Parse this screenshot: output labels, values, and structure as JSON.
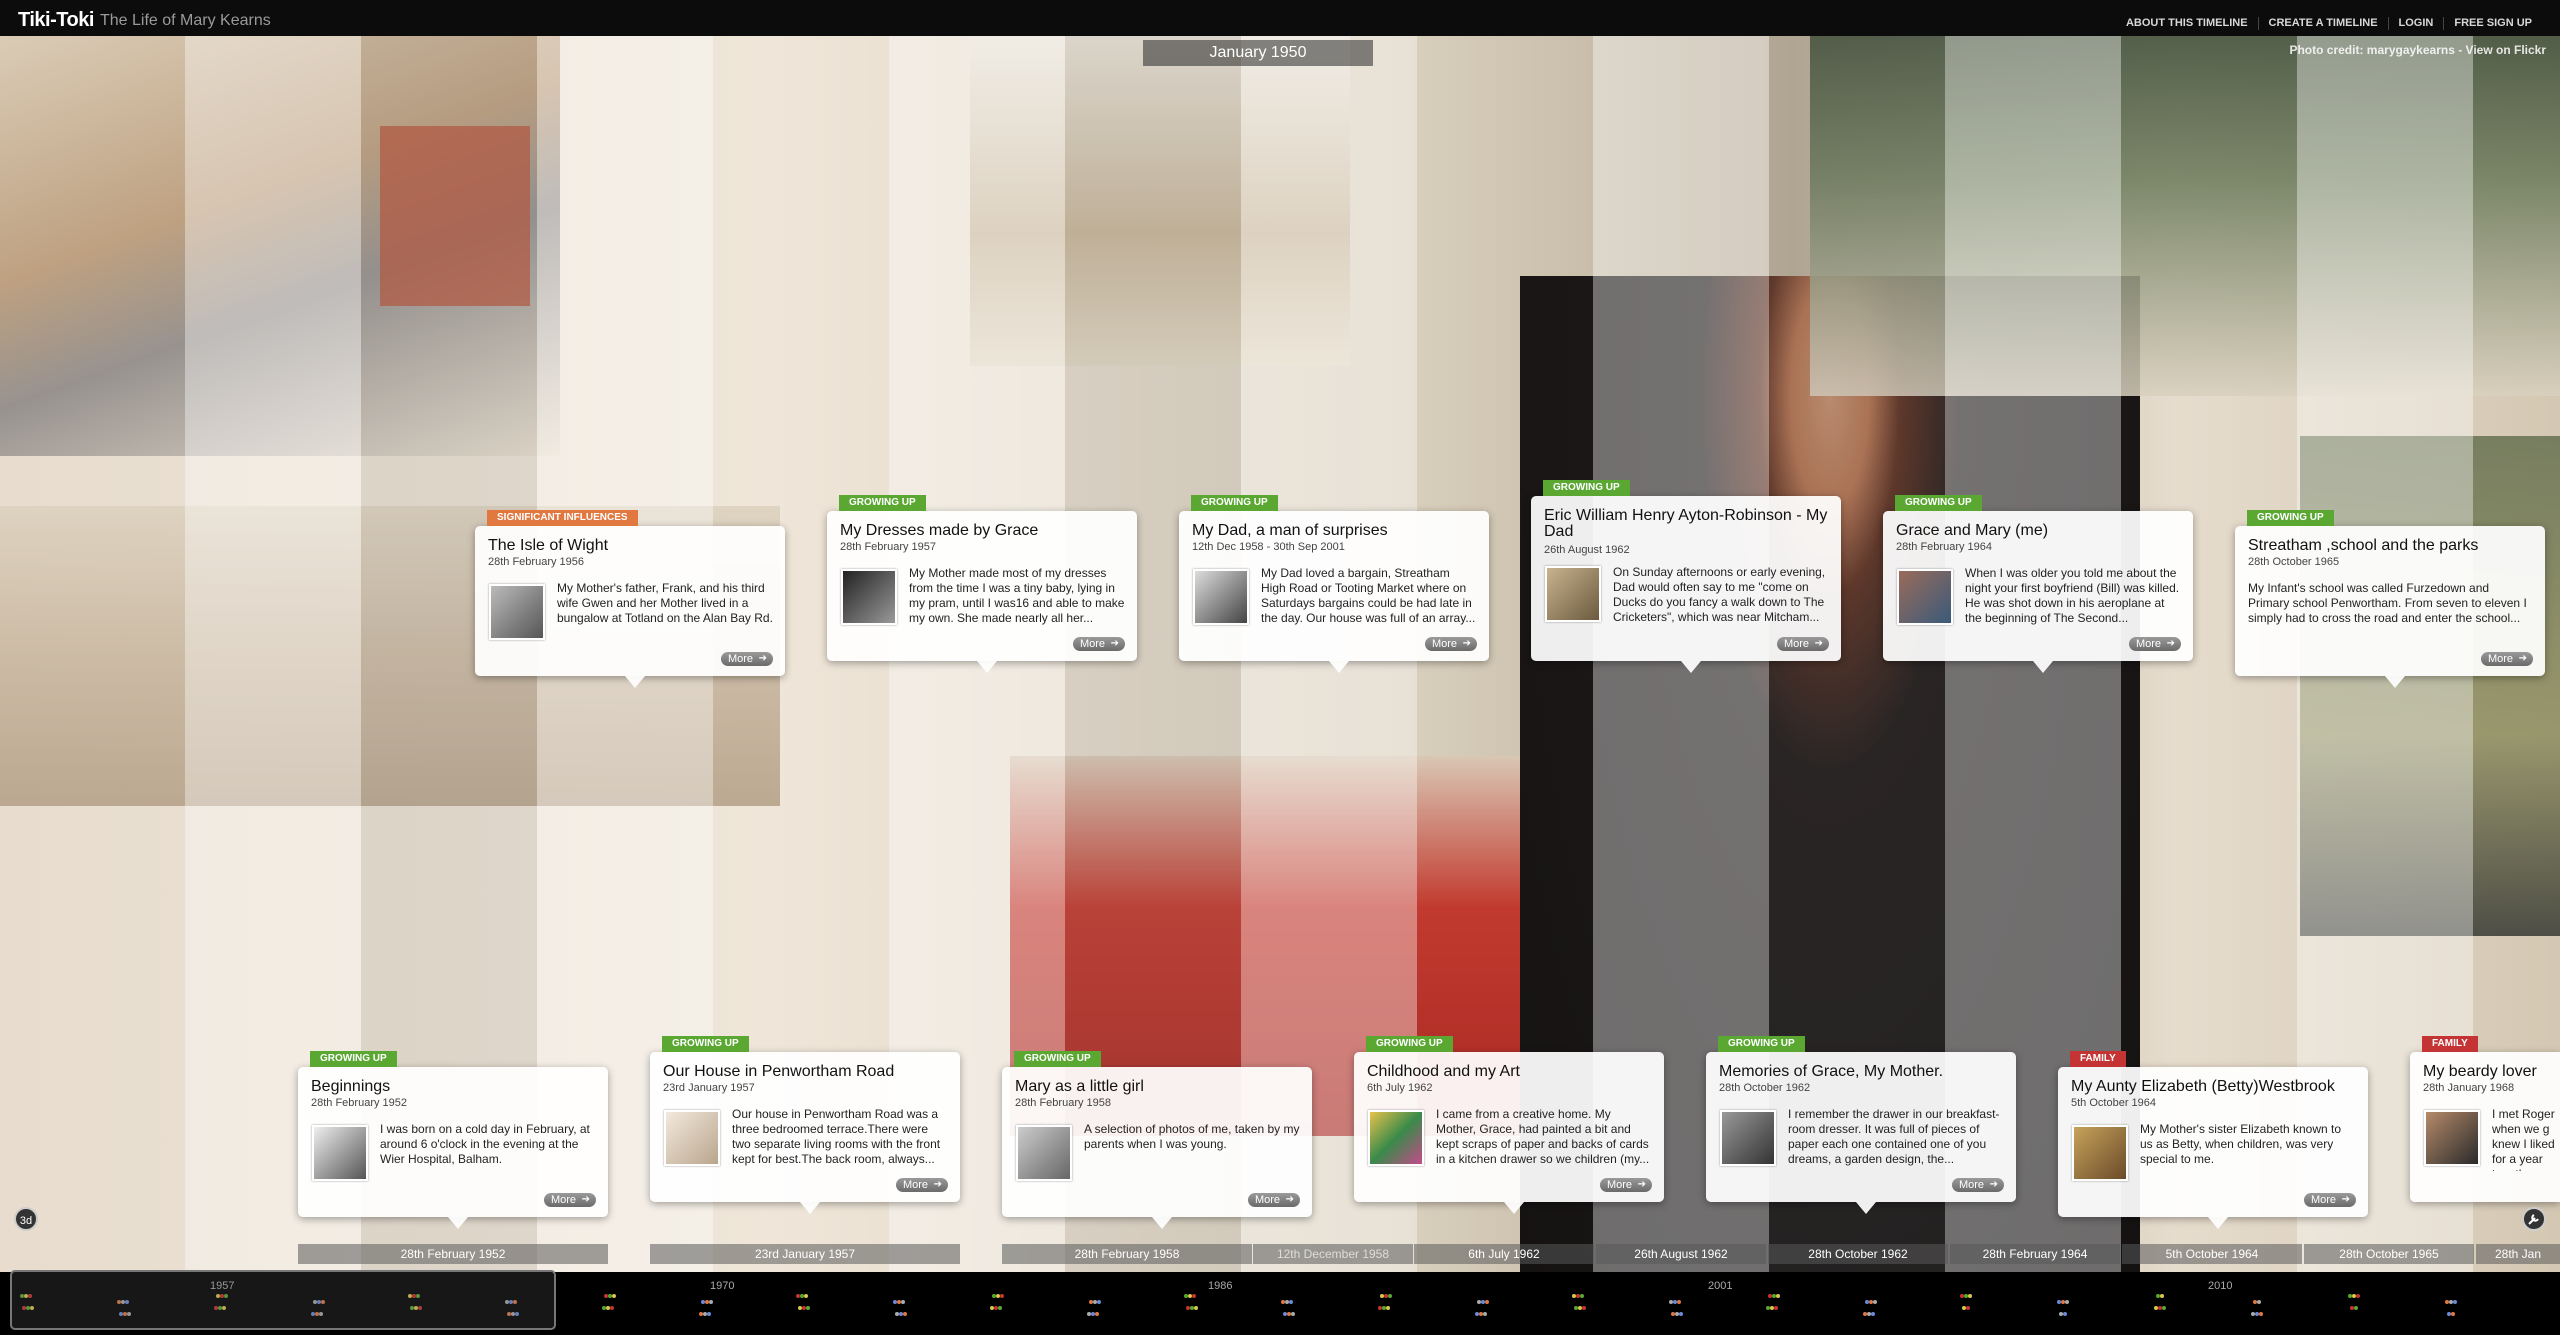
{
  "app": {
    "brand": "Tiki-Toki",
    "timeline_title": "The Life of Mary Kearns"
  },
  "topnav": [
    "ABOUT THIS TIMELINE",
    "CREATE A TIMELINE",
    "LOGIN",
    "FREE SIGN UP"
  ],
  "current_date": "January 1950",
  "photo_credit": "Photo credit: marygaykearns - View on Flickr",
  "controls": {
    "three_d": "3d",
    "settings_icon": "wrench-icon"
  },
  "colors": {
    "growing_up": "#5aa832",
    "significant": "#e07840",
    "family": "#c43434"
  },
  "stories_top": [
    {
      "category": "SIGNIFICANT INFLUENCES",
      "cat_class": "orange",
      "title": "The Isle of Wight",
      "date": "28th February 1956",
      "body": "My Mother's father, Frank, and his third wife Gwen and her Mother lived in a bungalow at Totland on the Alan Bay Rd.",
      "more": "More"
    },
    {
      "category": "GROWING UP",
      "cat_class": "green",
      "title": "My Dresses made by Grace",
      "date": "28th February 1957",
      "body": "My Mother made most of my dresses from the time I was a tiny baby, lying in my pram, until I was16 and able to make my own. She made nearly all her...",
      "more": "More"
    },
    {
      "category": "GROWING UP",
      "cat_class": "green",
      "title": "My Dad, a man of surprises",
      "date": "12th Dec 1958 - 30th Sep 2001",
      "body": "My Dad loved a bargain, Streatham High Road or Tooting Market where on Saturdays bargains could be had late in the day. Our house was full of an array...",
      "more": "More"
    },
    {
      "category": "GROWING UP",
      "cat_class": "green",
      "title": "Eric William Henry Ayton-Robinson - My Dad",
      "date": "26th August 1962",
      "body": "On Sunday afternoons or early evening, Dad would often say to me \"come on Ducks do you fancy a walk down to The Cricketers\", which was near Mitcham...",
      "more": "More"
    },
    {
      "category": "GROWING UP",
      "cat_class": "green",
      "title": "Grace and Mary (me)",
      "date": "28th February 1964",
      "body": "When I was older you told me about the night your first boyfriend (Bill) was killed. He was shot down in his aeroplane at the beginning of The Second...",
      "more": "More"
    },
    {
      "category": "GROWING UP",
      "cat_class": "green",
      "title": "Streatham ,school and the parks",
      "date": "28th October 1965",
      "body": "My Infant's school was called Furzedown and Primary school Penwortham. From seven to eleven I simply had to cross the road and enter the school...",
      "more": "More"
    }
  ],
  "stories_bottom": [
    {
      "category": "GROWING UP",
      "cat_class": "green",
      "title": "Beginnings",
      "date": "28th February 1952",
      "body": "I was born on a cold day in February, at around 6 o'clock in the evening at the Wier Hospital, Balham.",
      "more": "More"
    },
    {
      "category": "GROWING UP",
      "cat_class": "green",
      "title": "Our House in Penwortham Road",
      "date": "23rd January 1957",
      "body": "Our house in Penwortham Road was a three bedroomed terrace.There were two separate living rooms with the front kept for best.The back room, always...",
      "more": "More"
    },
    {
      "category": "GROWING UP",
      "cat_class": "green",
      "title": "Mary as a little girl",
      "date": "28th February 1958",
      "body": "A selection of photos of me, taken by my parents when I was young.",
      "more": "More"
    },
    {
      "category": "GROWING UP",
      "cat_class": "green",
      "title": "Childhood and my Art",
      "date": "6th July 1962",
      "body": "I came from a creative home. My Mother, Grace, had painted a bit and kept scraps of paper and backs of cards in a kitchen drawer so we children (my...",
      "more": "More"
    },
    {
      "category": "GROWING UP",
      "cat_class": "green",
      "title": "Memories of Grace, My Mother.",
      "date": "28th October 1962",
      "body": "I remember the drawer in our breakfast-room dresser. It was full of pieces of paper each one contained one of you dreams, a garden design, the...",
      "more": "More"
    },
    {
      "category": "FAMILY",
      "cat_class": "red",
      "title": "My Aunty Elizabeth (Betty)Westbrook",
      "date": "5th October 1964",
      "body": "My Mother's sister Elizabeth known to us as Betty, when children, was very special to me.",
      "more": "More"
    },
    {
      "category": "FAMILY",
      "cat_class": "red",
      "title": "My beardy lover",
      "date": "28th January 1968",
      "body": "I met Roger when we g knew I liked for a year together.",
      "more": "More"
    }
  ],
  "axis_labels": [
    "28th February 1952",
    "23rd January 1957",
    "28th February 1958",
    "12th December 1958",
    "6th July 1962",
    "26th August 1962",
    "28th October 1962",
    "28th February 1964",
    "5th October 1964",
    "28th October 1965",
    "28th Jan"
  ],
  "navigator": {
    "years": [
      "1957",
      "1970",
      "1986",
      "2001",
      "2010"
    ]
  }
}
